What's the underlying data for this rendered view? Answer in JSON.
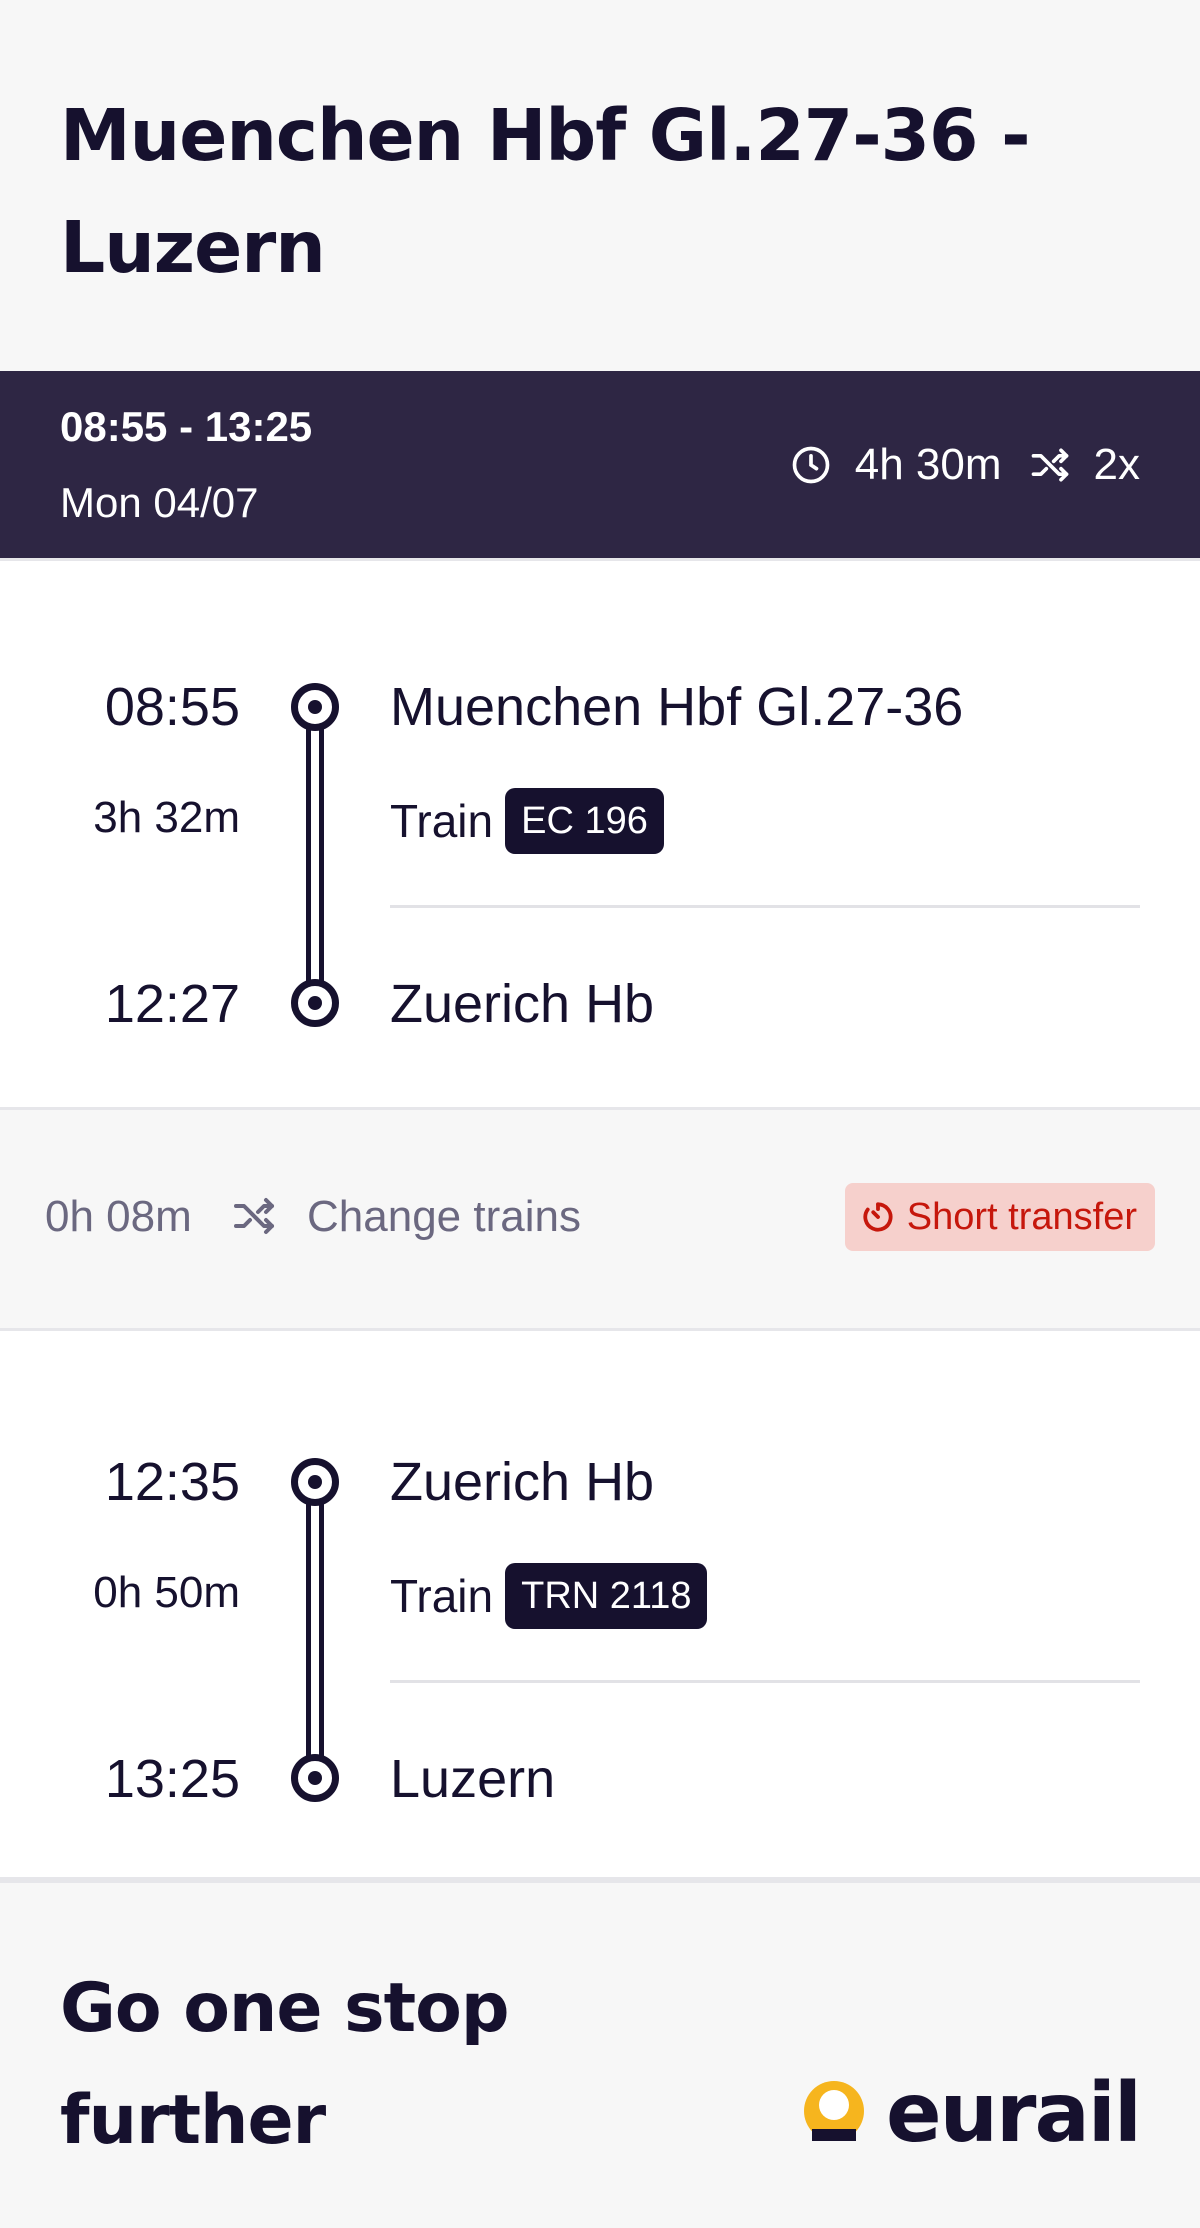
{
  "header": {
    "title": "Muenchen Hbf Gl.27-36 - Luzern"
  },
  "summary": {
    "times": "08:55 - 13:25",
    "date": "Mon 04/07",
    "duration": "4h 30m",
    "transfers": "2x",
    "duration_icon": "clock-icon",
    "transfers_icon": "shuffle-icon"
  },
  "legs": [
    {
      "departure_time": "08:55",
      "duration": "3h 32m",
      "arrival_time": "12:27",
      "from": "Muenchen Hbf Gl.27-36",
      "mode": "Train",
      "train": "EC 196",
      "to": "Zuerich Hb"
    },
    {
      "departure_time": "12:35",
      "duration": "0h 50m",
      "arrival_time": "13:25",
      "from": "Zuerich Hb",
      "mode": "Train",
      "train": "TRN 2118",
      "to": "Luzern"
    }
  ],
  "transfer": {
    "wait": "0h 08m",
    "label": "Change trains",
    "warning": "Short transfer",
    "warning_icon": "timer-icon",
    "colors": {
      "warning_bg": "#f6d0cc",
      "warning_text": "#c6170c"
    }
  },
  "footer": {
    "title": "Go one stop further",
    "logo_text": "eurail",
    "colors": {
      "logo_accent": "#f6b51e",
      "brand_dark": "#16112e"
    }
  }
}
